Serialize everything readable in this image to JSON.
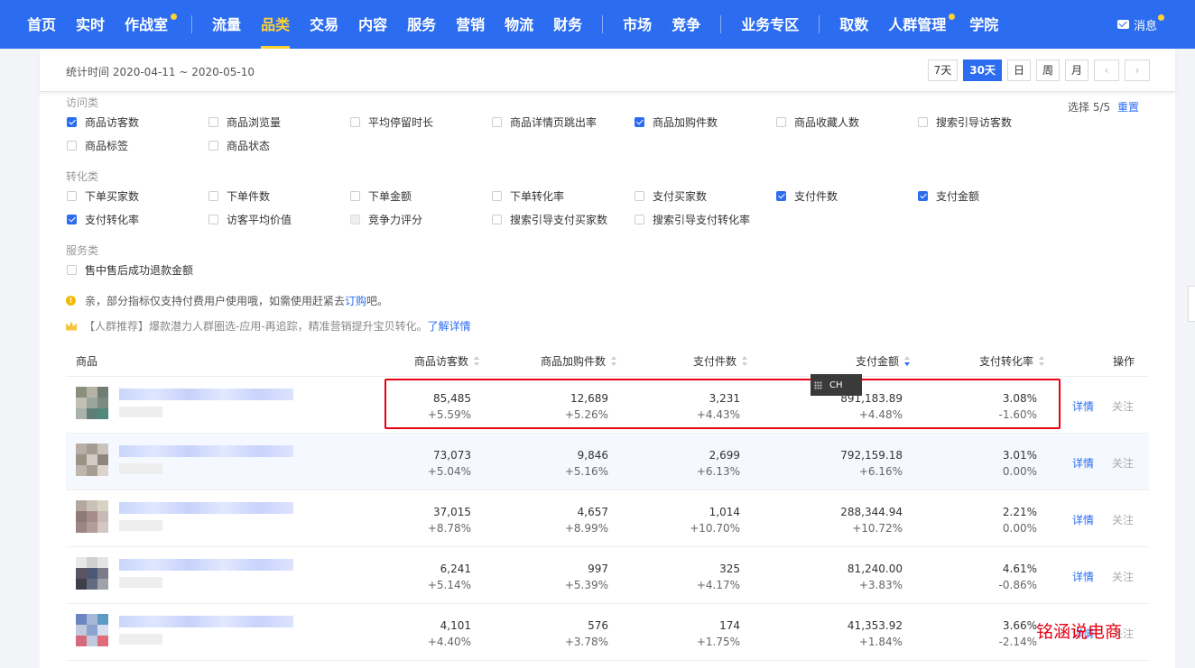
{
  "nav": {
    "groups": [
      [
        {
          "label": "首页"
        },
        {
          "label": "实时"
        },
        {
          "label": "作战室",
          "dot": true
        }
      ],
      [
        {
          "label": "流量"
        },
        {
          "label": "品类",
          "active": true
        },
        {
          "label": "交易"
        },
        {
          "label": "内容"
        },
        {
          "label": "服务"
        },
        {
          "label": "营销"
        },
        {
          "label": "物流"
        },
        {
          "label": "财务"
        }
      ],
      [
        {
          "label": "市场"
        },
        {
          "label": "竞争"
        }
      ],
      [
        {
          "label": "业务专区"
        }
      ],
      [
        {
          "label": "取数"
        },
        {
          "label": "人群管理",
          "dot": true
        },
        {
          "label": "学院"
        }
      ]
    ],
    "message_label": "消息"
  },
  "date": {
    "text": "统计时间 2020-04-11 ~ 2020-05-10",
    "buttons": [
      {
        "label": "7天"
      },
      {
        "label": "30天",
        "active": true
      },
      {
        "label": "日"
      },
      {
        "label": "周"
      },
      {
        "label": "月"
      }
    ],
    "prev": "‹",
    "next": "›"
  },
  "selection": {
    "text": "选择 5/5",
    "reset": "重置"
  },
  "groups": [
    {
      "title": "访问类",
      "items": [
        {
          "label": "商品访客数",
          "checked": true
        },
        {
          "label": "商品浏览量"
        },
        {
          "label": "平均停留时长"
        },
        {
          "label": "商品详情页跳出率"
        },
        {
          "label": "商品加购件数",
          "checked": true
        },
        {
          "label": "商品收藏人数"
        },
        {
          "label": "搜索引导访客数"
        },
        {
          "label": "商品标签"
        },
        {
          "label": "商品状态"
        }
      ]
    },
    {
      "title": "转化类",
      "items": [
        {
          "label": "下单买家数"
        },
        {
          "label": "下单件数"
        },
        {
          "label": "下单金额"
        },
        {
          "label": "下单转化率"
        },
        {
          "label": "支付买家数"
        },
        {
          "label": "支付件数",
          "checked": true
        },
        {
          "label": "支付金额",
          "checked": true
        },
        {
          "label": "支付转化率",
          "checked": true
        },
        {
          "label": "访客平均价值"
        },
        {
          "label": "竞争力评分",
          "disabled": true
        },
        {
          "label": "搜索引导支付买家数"
        },
        {
          "label": "搜索引导支付转化率"
        }
      ]
    },
    {
      "title": "服务类",
      "items": [
        {
          "label": "售中售后成功退款金额"
        }
      ]
    }
  ],
  "notices": {
    "paid_prefix": "亲，部分指标仅支持付费用户使用哦，如需使用赶紧去 ",
    "paid_link": "订购",
    "paid_suffix": "吧。",
    "crowd_text": "【人群推荐】爆款潜力人群圈选-应用-再追踪，精准营销提升宝贝转化。",
    "crowd_link": "了解详情"
  },
  "table": {
    "headers": {
      "product": "商品",
      "visitors": "商品访客数",
      "cart": "商品加购件数",
      "pay_items": "支付件数",
      "pay_amount": "支付金额",
      "pay_rate": "支付转化率",
      "action": "操作"
    },
    "rows": [
      {
        "visitors": "85,485",
        "visitors_chg": "+5.59%",
        "cart": "12,689",
        "cart_chg": "+5.26%",
        "pay_items": "3,231",
        "pay_items_chg": "+4.43%",
        "pay_amount": "891,183.89",
        "pay_amount_chg": "+4.48%",
        "pay_rate": "3.08%",
        "pay_rate_chg": "-1.60%",
        "detail": "详情",
        "follow": "关注"
      },
      {
        "visitors": "73,073",
        "visitors_chg": "+5.04%",
        "cart": "9,846",
        "cart_chg": "+5.16%",
        "pay_items": "2,699",
        "pay_items_chg": "+6.13%",
        "pay_amount": "792,159.18",
        "pay_amount_chg": "+6.16%",
        "pay_rate": "3.01%",
        "pay_rate_chg": "0.00%",
        "detail": "详情",
        "follow": "关注"
      },
      {
        "visitors": "37,015",
        "visitors_chg": "+8.78%",
        "cart": "4,657",
        "cart_chg": "+8.99%",
        "pay_items": "1,014",
        "pay_items_chg": "+10.70%",
        "pay_amount": "288,344.94",
        "pay_amount_chg": "+10.72%",
        "pay_rate": "2.21%",
        "pay_rate_chg": "0.00%",
        "detail": "详情",
        "follow": "关注"
      },
      {
        "visitors": "6,241",
        "visitors_chg": "+5.14%",
        "cart": "997",
        "cart_chg": "+5.39%",
        "pay_items": "325",
        "pay_items_chg": "+4.17%",
        "pay_amount": "81,240.00",
        "pay_amount_chg": "+3.83%",
        "pay_rate": "4.61%",
        "pay_rate_chg": "-0.86%",
        "detail": "详情",
        "follow": "关注"
      },
      {
        "visitors": "4,101",
        "visitors_chg": "+4.40%",
        "cart": "576",
        "cart_chg": "+3.78%",
        "pay_items": "174",
        "pay_items_chg": "+1.75%",
        "pay_amount": "41,353.92",
        "pay_amount_chg": "+1.84%",
        "pay_rate": "3.66%",
        "pay_rate_chg": "-2.14%",
        "detail": "详情",
        "follow": "关注"
      }
    ]
  },
  "ime_label": "CH",
  "watermark": "铭涵说电商"
}
